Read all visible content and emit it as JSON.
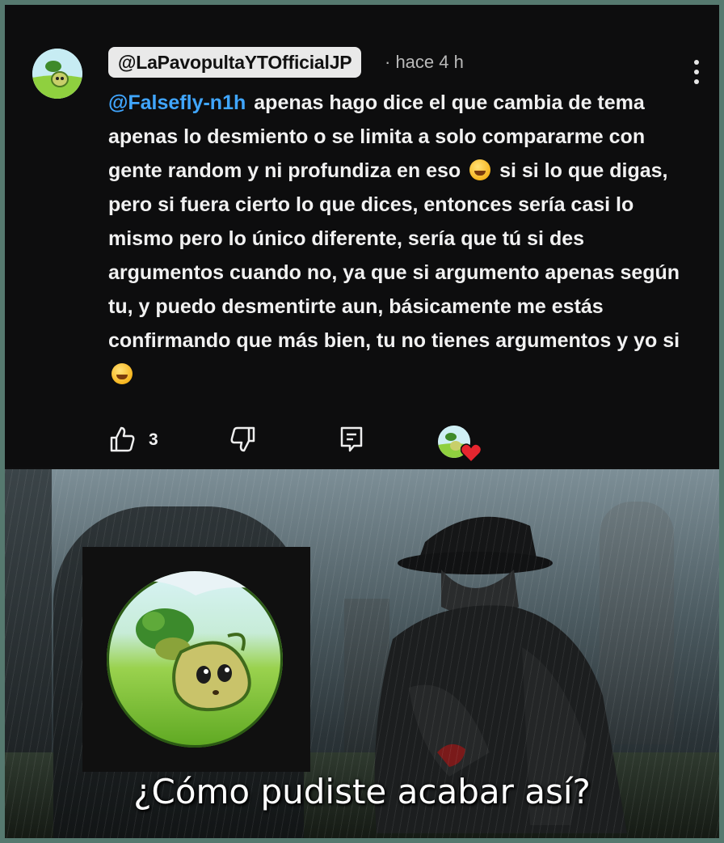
{
  "comment": {
    "author": "@LaPavopultaYTOfficialJP",
    "timestamp": "· hace 4 h",
    "mention": "@Falsefly-n1h",
    "text_part1": "apenas hago dice el que cambia de tema apenas lo desmiento o se limita a solo compararme con gente random y ni profundiza en eso",
    "text_part2": "si si lo que digas, pero si fuera cierto lo que dices, entonces sería casi lo mismo pero lo único diferente, sería que tú si des argumentos cuando no, ya que si argumento apenas según tu, y  puedo desmentirte aun, básicamente me estás confirmando que más bien, tu no tienes argumentos y yo si",
    "like_count": "3",
    "icons": {
      "menu": "more-vert-icon",
      "like": "thumbs-up-icon",
      "dislike": "thumbs-down-icon",
      "reply": "reply-comment-icon",
      "creator_heart": "creator-heart-icon",
      "emoji": "grinning-sweat-emoji"
    },
    "colors": {
      "mention": "#40a6ff",
      "background": "#0d0d0e",
      "heart": "#e6262f"
    }
  },
  "meme": {
    "caption": "¿Cómo pudiste acabar así?",
    "image": "man-in-hat-kneeling-at-grave-in-rain"
  }
}
